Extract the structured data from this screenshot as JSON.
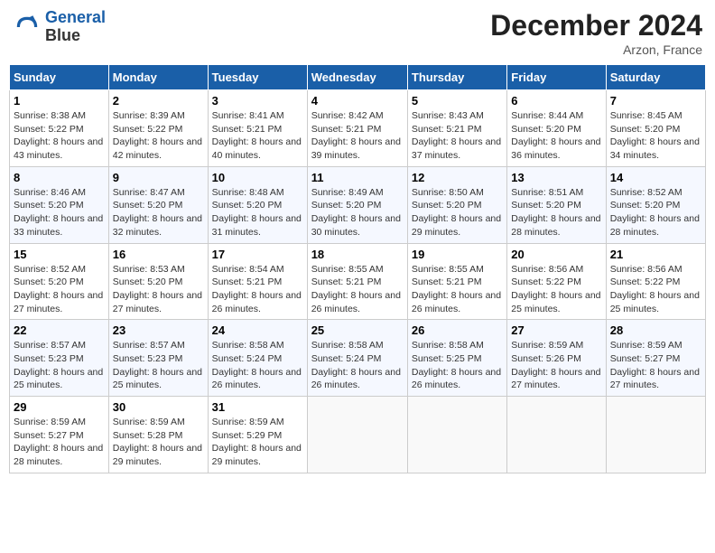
{
  "header": {
    "logo_line1": "General",
    "logo_line2": "Blue",
    "month": "December 2024",
    "location": "Arzon, France"
  },
  "weekdays": [
    "Sunday",
    "Monday",
    "Tuesday",
    "Wednesday",
    "Thursday",
    "Friday",
    "Saturday"
  ],
  "weeks": [
    [
      {
        "day": "1",
        "sunrise": "8:38 AM",
        "sunset": "5:22 PM",
        "daylight": "8 hours and 43 minutes."
      },
      {
        "day": "2",
        "sunrise": "8:39 AM",
        "sunset": "5:22 PM",
        "daylight": "8 hours and 42 minutes."
      },
      {
        "day": "3",
        "sunrise": "8:41 AM",
        "sunset": "5:21 PM",
        "daylight": "8 hours and 40 minutes."
      },
      {
        "day": "4",
        "sunrise": "8:42 AM",
        "sunset": "5:21 PM",
        "daylight": "8 hours and 39 minutes."
      },
      {
        "day": "5",
        "sunrise": "8:43 AM",
        "sunset": "5:21 PM",
        "daylight": "8 hours and 37 minutes."
      },
      {
        "day": "6",
        "sunrise": "8:44 AM",
        "sunset": "5:20 PM",
        "daylight": "8 hours and 36 minutes."
      },
      {
        "day": "7",
        "sunrise": "8:45 AM",
        "sunset": "5:20 PM",
        "daylight": "8 hours and 34 minutes."
      }
    ],
    [
      {
        "day": "8",
        "sunrise": "8:46 AM",
        "sunset": "5:20 PM",
        "daylight": "8 hours and 33 minutes."
      },
      {
        "day": "9",
        "sunrise": "8:47 AM",
        "sunset": "5:20 PM",
        "daylight": "8 hours and 32 minutes."
      },
      {
        "day": "10",
        "sunrise": "8:48 AM",
        "sunset": "5:20 PM",
        "daylight": "8 hours and 31 minutes."
      },
      {
        "day": "11",
        "sunrise": "8:49 AM",
        "sunset": "5:20 PM",
        "daylight": "8 hours and 30 minutes."
      },
      {
        "day": "12",
        "sunrise": "8:50 AM",
        "sunset": "5:20 PM",
        "daylight": "8 hours and 29 minutes."
      },
      {
        "day": "13",
        "sunrise": "8:51 AM",
        "sunset": "5:20 PM",
        "daylight": "8 hours and 28 minutes."
      },
      {
        "day": "14",
        "sunrise": "8:52 AM",
        "sunset": "5:20 PM",
        "daylight": "8 hours and 28 minutes."
      }
    ],
    [
      {
        "day": "15",
        "sunrise": "8:52 AM",
        "sunset": "5:20 PM",
        "daylight": "8 hours and 27 minutes."
      },
      {
        "day": "16",
        "sunrise": "8:53 AM",
        "sunset": "5:20 PM",
        "daylight": "8 hours and 27 minutes."
      },
      {
        "day": "17",
        "sunrise": "8:54 AM",
        "sunset": "5:21 PM",
        "daylight": "8 hours and 26 minutes."
      },
      {
        "day": "18",
        "sunrise": "8:55 AM",
        "sunset": "5:21 PM",
        "daylight": "8 hours and 26 minutes."
      },
      {
        "day": "19",
        "sunrise": "8:55 AM",
        "sunset": "5:21 PM",
        "daylight": "8 hours and 26 minutes."
      },
      {
        "day": "20",
        "sunrise": "8:56 AM",
        "sunset": "5:22 PM",
        "daylight": "8 hours and 25 minutes."
      },
      {
        "day": "21",
        "sunrise": "8:56 AM",
        "sunset": "5:22 PM",
        "daylight": "8 hours and 25 minutes."
      }
    ],
    [
      {
        "day": "22",
        "sunrise": "8:57 AM",
        "sunset": "5:23 PM",
        "daylight": "8 hours and 25 minutes."
      },
      {
        "day": "23",
        "sunrise": "8:57 AM",
        "sunset": "5:23 PM",
        "daylight": "8 hours and 25 minutes."
      },
      {
        "day": "24",
        "sunrise": "8:58 AM",
        "sunset": "5:24 PM",
        "daylight": "8 hours and 26 minutes."
      },
      {
        "day": "25",
        "sunrise": "8:58 AM",
        "sunset": "5:24 PM",
        "daylight": "8 hours and 26 minutes."
      },
      {
        "day": "26",
        "sunrise": "8:58 AM",
        "sunset": "5:25 PM",
        "daylight": "8 hours and 26 minutes."
      },
      {
        "day": "27",
        "sunrise": "8:59 AM",
        "sunset": "5:26 PM",
        "daylight": "8 hours and 27 minutes."
      },
      {
        "day": "28",
        "sunrise": "8:59 AM",
        "sunset": "5:27 PM",
        "daylight": "8 hours and 27 minutes."
      }
    ],
    [
      {
        "day": "29",
        "sunrise": "8:59 AM",
        "sunset": "5:27 PM",
        "daylight": "8 hours and 28 minutes."
      },
      {
        "day": "30",
        "sunrise": "8:59 AM",
        "sunset": "5:28 PM",
        "daylight": "8 hours and 29 minutes."
      },
      {
        "day": "31",
        "sunrise": "8:59 AM",
        "sunset": "5:29 PM",
        "daylight": "8 hours and 29 minutes."
      },
      null,
      null,
      null,
      null
    ]
  ]
}
